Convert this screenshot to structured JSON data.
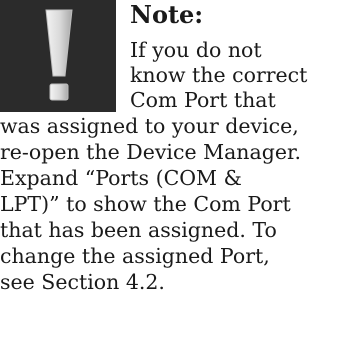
{
  "note": {
    "icon": "exclamation-icon",
    "icon_background": "#2b2b2b",
    "title": "Note:",
    "lines": [
      "If you do not",
      "know the correct",
      "Com Port that",
      "was assigned to your device,",
      "re-open the Device Manager.",
      "Expand “Ports (COM &",
      "LPT)” to show the Com Port",
      "that has been assigned. To",
      "change the assigned Port,",
      "see Section 4.2."
    ]
  }
}
